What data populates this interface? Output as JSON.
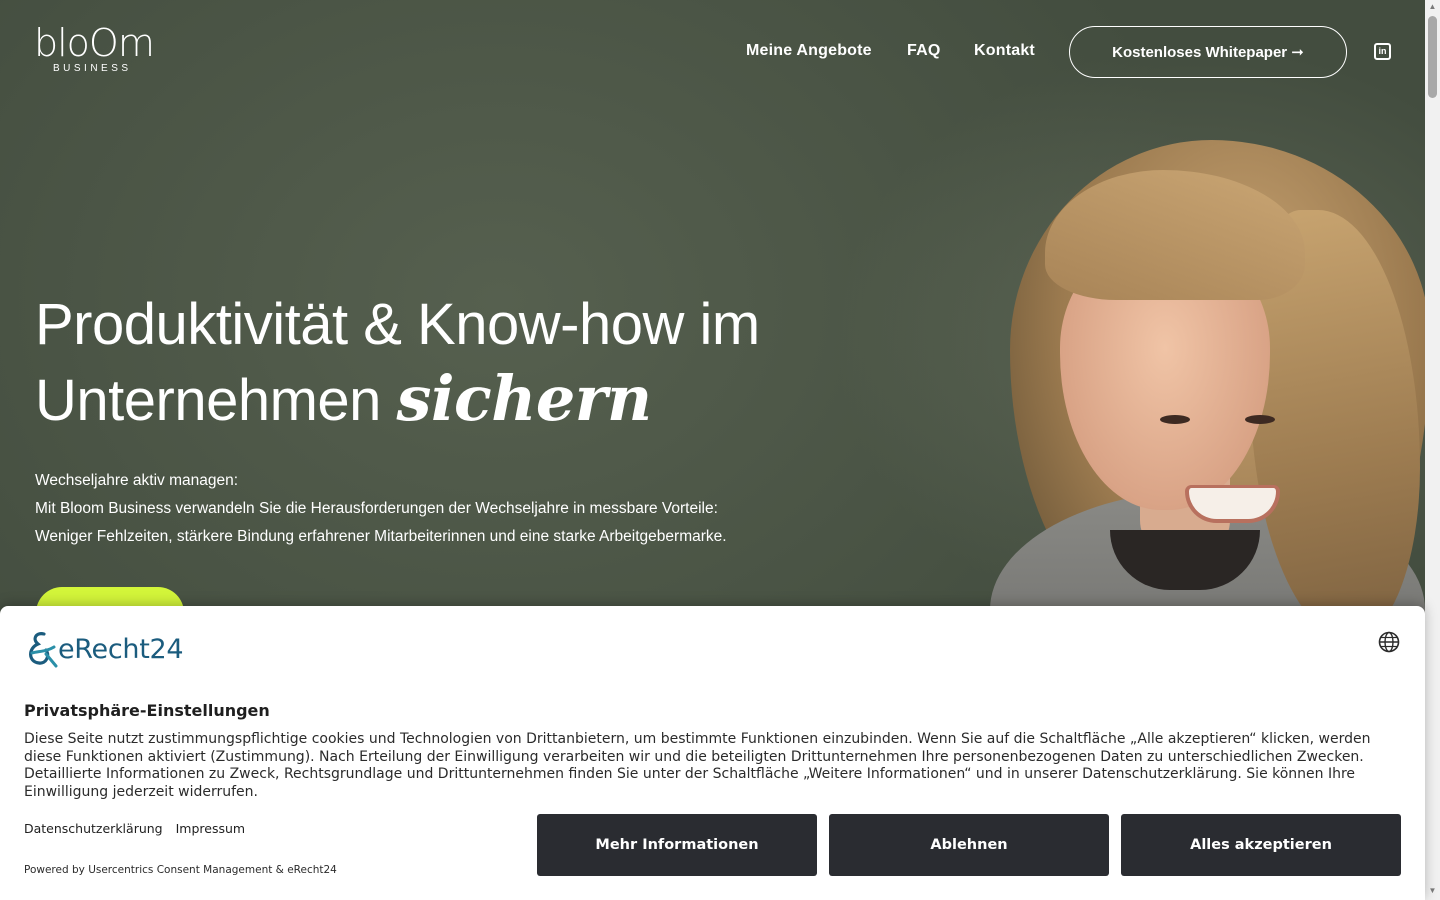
{
  "logo": {
    "main": "bloOm",
    "sub": "BUSINESS"
  },
  "nav": {
    "items": [
      "Meine Angebote",
      "FAQ",
      "Kontakt"
    ],
    "cta": "Kostenloses Whitepaper ➞",
    "linkedin_icon": "linkedin-icon"
  },
  "hero": {
    "headline_line1": "Produktivität & Know-how im",
    "headline_line2": "Unternehmen ",
    "headline_accent": "sichern",
    "intro": [
      "Wechseljahre aktiv managen:",
      "Mit Bloom Business verwandeln Sie die Herausforderungen der Wechseljahre in messbare Vorteile:",
      "Weniger Fehlzeiten, stärkere Bindung erfahrener Mitarbeiterinnen und eine starke Arbeitgebermarke."
    ],
    "cta_color": "#d3f53a"
  },
  "consent": {
    "brand": "eRecht24",
    "title": "Privatsphäre-Einstellungen",
    "body": "Diese Seite nutzt zustimmungspflichtige cookies und Technologien von Drittanbietern, um bestimmte Funktionen einzubinden. Wenn Sie auf die Schaltfläche „Alle akzeptieren“ klicken, werden diese Funktionen aktiviert (Zustimmung). Nach Erteilung der Einwilligung verarbeiten wir und die beteiligten Drittunternehmen Ihre personenbezogenen Daten zu unterschiedlichen Zwecken. Detaillierte Informationen zu Zweck, Rechtsgrundlage und Drittunternehmen finden Sie unter der Schaltfläche „Weitere Informationen“ und in unserer Datenschutzerklärung. Sie können Ihre Einwilligung jederzeit widerrufen.",
    "links": [
      "Datenschutzerklärung",
      "Impressum"
    ],
    "powered": "Powered by Usercentrics Consent Management & eRecht24",
    "buttons": [
      "Mehr Informationen",
      "Ablehnen",
      "Alles akzeptieren"
    ],
    "button_color": "#2a2c31",
    "brand_color": "#1b5c7e"
  }
}
